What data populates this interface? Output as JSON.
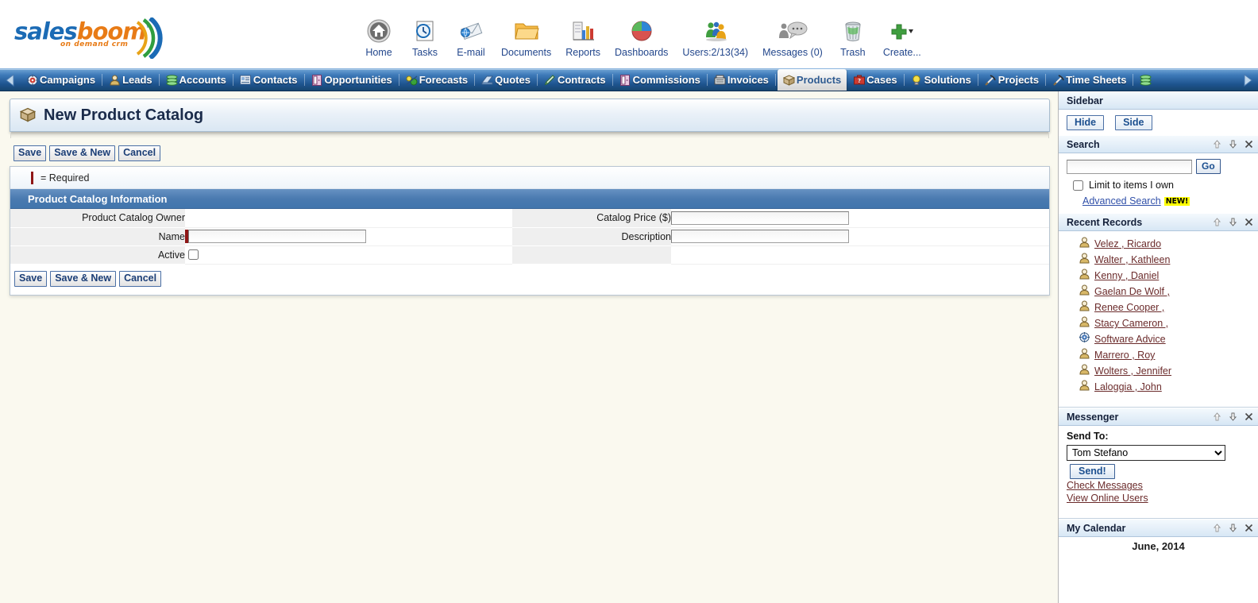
{
  "brand": {
    "name_part1": "sales",
    "name_part2": "boom",
    "tm": "™",
    "tagline": "on demand crm",
    "blue": "#1b6bb5",
    "orange": "#e87b16",
    "green": "#4aa832"
  },
  "quicknav": [
    {
      "label": "Home",
      "icon": "home-icon"
    },
    {
      "label": "Tasks",
      "icon": "tasks-clock-icon"
    },
    {
      "label": "E-mail",
      "icon": "email-icon"
    },
    {
      "label": "Documents",
      "icon": "folder-icon"
    },
    {
      "label": "Reports",
      "icon": "reports-chart-icon"
    },
    {
      "label": "Dashboards",
      "icon": "dashboard-pie-icon"
    },
    {
      "label": "Users:2/13(34)",
      "icon": "users-icon"
    },
    {
      "label": "Messages (0)",
      "icon": "messages-icon"
    },
    {
      "label": "Trash",
      "icon": "trash-icon"
    },
    {
      "label": "Create...",
      "icon": "create-plus-icon"
    }
  ],
  "tabs": {
    "prev_label": "◀",
    "next_label": "▶",
    "items": [
      {
        "label": "Campaigns",
        "icon": "campaign-target-icon",
        "active": false
      },
      {
        "label": "Leads",
        "icon": "lead-person-icon",
        "active": false
      },
      {
        "label": "Accounts",
        "icon": "accounts-stack-icon",
        "active": false
      },
      {
        "label": "Contacts",
        "icon": "contacts-card-icon",
        "active": false
      },
      {
        "label": "Opportunities",
        "icon": "opportunity-door-icon",
        "active": false
      },
      {
        "label": "Forecasts",
        "icon": "forecast-icon",
        "active": false
      },
      {
        "label": "Quotes",
        "icon": "quotes-icon",
        "active": false
      },
      {
        "label": "Contracts",
        "icon": "contracts-pen-icon",
        "active": false
      },
      {
        "label": "Commissions",
        "icon": "commissions-icon",
        "active": false
      },
      {
        "label": "Invoices",
        "icon": "invoices-register-icon",
        "active": false
      },
      {
        "label": "Products",
        "icon": "products-box-icon",
        "active": true
      },
      {
        "label": "Cases",
        "icon": "cases-briefcase-icon",
        "active": false
      },
      {
        "label": "Solutions",
        "icon": "solutions-bulb-icon",
        "active": false
      },
      {
        "label": "Projects",
        "icon": "projects-hammer-icon",
        "active": false
      },
      {
        "label": "Time Sheets",
        "icon": "timesheets-hammer-icon",
        "active": false
      },
      {
        "label": "",
        "icon": "more-stack-icon",
        "active": false
      }
    ]
  },
  "page": {
    "title": "New Product Catalog",
    "title_icon": "products-box-icon",
    "required_legend": "= Required",
    "section_title": "Product Catalog Information"
  },
  "buttons": {
    "save": "Save",
    "save_new": "Save & New",
    "cancel": "Cancel"
  },
  "form": {
    "left": [
      {
        "label": "Product Catalog Owner",
        "type": "text-readonly",
        "value": "",
        "required": false,
        "has_input": false
      },
      {
        "label": "Name",
        "type": "text",
        "value": "",
        "required": true,
        "has_input": true
      },
      {
        "label": "Active",
        "type": "checkbox",
        "value": "",
        "checked": false,
        "required": false,
        "has_input": true
      }
    ],
    "right": [
      {
        "label": "Catalog Price ($)",
        "type": "text",
        "value": "",
        "required": false,
        "has_input": true
      },
      {
        "label": "Description",
        "type": "text",
        "value": "",
        "required": false,
        "has_input": true
      },
      {
        "label": "",
        "type": "blank",
        "value": "",
        "required": false,
        "has_input": false
      }
    ]
  },
  "sidebar": {
    "title": "Sidebar",
    "hide_label": "Hide",
    "side_label": "Side",
    "search": {
      "title": "Search",
      "value": "",
      "go_label": "Go",
      "limit_label": "Limit to items I own",
      "limit_checked": false,
      "advanced_label": "Advanced Search",
      "new_badge": "NEW!"
    },
    "recent": {
      "title": "Recent Records",
      "items": [
        {
          "label": "Velez , Ricardo",
          "icon": "contact-person-icon"
        },
        {
          "label": "Walter , Kathleen",
          "icon": "contact-person-icon"
        },
        {
          "label": "Kenny , Daniel",
          "icon": "contact-person-icon"
        },
        {
          "label": "Gaelan De Wolf ,",
          "icon": "contact-person-icon"
        },
        {
          "label": "Renee Cooper ,",
          "icon": "contact-person-icon"
        },
        {
          "label": "Stacy Cameron ,",
          "icon": "contact-person-icon"
        },
        {
          "label": "Software Advice",
          "icon": "campaign-target-icon"
        },
        {
          "label": "Marrero , Roy",
          "icon": "contact-person-icon"
        },
        {
          "label": "Wolters , Jennifer",
          "icon": "contact-person-icon"
        },
        {
          "label": "Laloggia , John",
          "icon": "contact-person-icon"
        }
      ]
    },
    "messenger": {
      "title": "Messenger",
      "send_to_label": "Send To:",
      "selected_user": "Tom Stefano",
      "options": [
        "Tom Stefano"
      ],
      "send_label": "Send!",
      "check_messages": "Check Messages",
      "view_online": "View Online Users"
    },
    "calendar": {
      "title": "My Calendar",
      "month": "June, 2014"
    },
    "panel_controls": {
      "up": "⇧",
      "down": "⇩",
      "close": "✕"
    }
  }
}
